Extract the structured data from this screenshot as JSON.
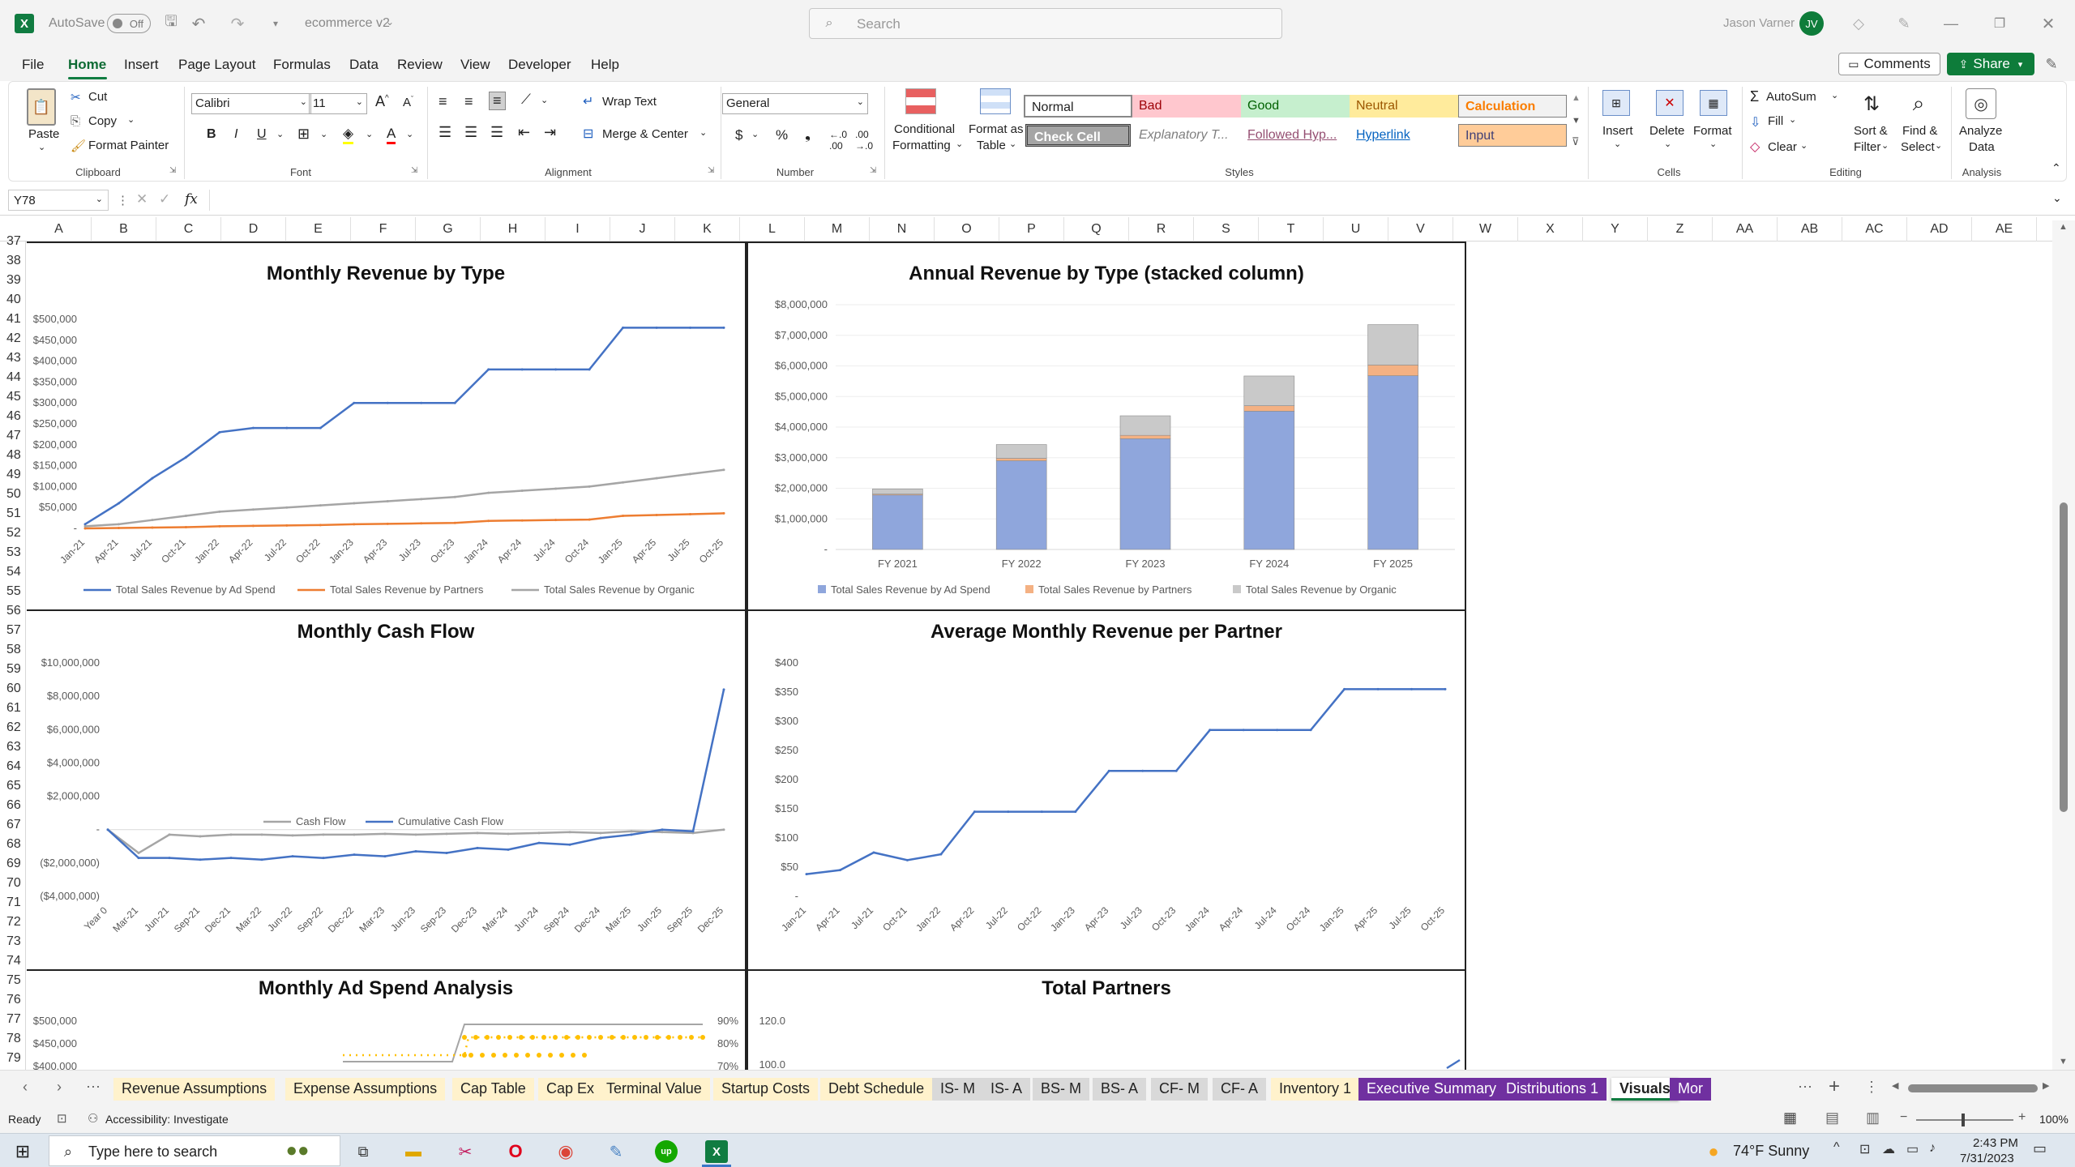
{
  "titlebar": {
    "autosave": "AutoSave",
    "autosave_state": "Off",
    "filename": "ecommerce v2",
    "search_placeholder": "Search",
    "user": "Jason Varner",
    "initials": "JV"
  },
  "menu": [
    "File",
    "Home",
    "Insert",
    "Page Layout",
    "Formulas",
    "Data",
    "Review",
    "View",
    "Developer",
    "Help"
  ],
  "menu_right": {
    "comments": "Comments",
    "share": "Share"
  },
  "ribbon": {
    "clipboard": {
      "paste": "Paste",
      "cut": "Cut",
      "copy": "Copy",
      "format_painter": "Format Painter",
      "label": "Clipboard"
    },
    "font": {
      "name": "Calibri",
      "size": "11",
      "label": "Font"
    },
    "alignment": {
      "wrap": "Wrap Text",
      "merge": "Merge & Center",
      "label": "Alignment"
    },
    "number": {
      "format": "General",
      "label": "Number"
    },
    "styles": {
      "conditional": "Conditional",
      "conditional2": "Formatting",
      "format_as": "Format as",
      "format_as2": "Table",
      "label": "Styles",
      "cells": [
        "Normal",
        "Bad",
        "Good",
        "Neutral",
        "Calculation",
        "Check Cell",
        "Explanatory T...",
        "Followed Hyp...",
        "Hyperlink",
        "Input"
      ]
    },
    "cells": {
      "insert": "Insert",
      "delete": "Delete",
      "format": "Format",
      "label": "Cells"
    },
    "editing": {
      "autosum": "AutoSum",
      "fill": "Fill",
      "clear": "Clear",
      "sort": "Sort &",
      "sort2": "Filter",
      "find": "Find &",
      "find2": "Select",
      "label": "Editing"
    },
    "analysis": {
      "analyze": "Analyze",
      "analyze2": "Data",
      "label": "Analysis"
    }
  },
  "formula_bar": {
    "name_box": "Y78",
    "fx": "fx"
  },
  "columns": [
    "A",
    "B",
    "C",
    "D",
    "E",
    "F",
    "G",
    "H",
    "I",
    "J",
    "K",
    "L",
    "M",
    "N",
    "O",
    "P",
    "Q",
    "R",
    "S",
    "T",
    "U",
    "V",
    "W",
    "X",
    "Y",
    "Z",
    "AA",
    "AB",
    "AC",
    "AD",
    "AE"
  ],
  "rows": [
    "37",
    "38",
    "39",
    "40",
    "41",
    "42",
    "43",
    "44",
    "45",
    "46",
    "47",
    "48",
    "49",
    "50",
    "51",
    "52",
    "53",
    "54",
    "55",
    "56",
    "57",
    "58",
    "59",
    "60",
    "61",
    "62",
    "63",
    "64",
    "65",
    "66",
    "67",
    "68",
    "69",
    "70",
    "71",
    "72",
    "73",
    "74",
    "75",
    "76",
    "77",
    "78",
    "79"
  ],
  "chart_data": [
    {
      "type": "line",
      "title": "Monthly Revenue by Type",
      "x": [
        "Jan-21",
        "Apr-21",
        "Jul-21",
        "Oct-21",
        "Jan-22",
        "Apr-22",
        "Jul-22",
        "Oct-22",
        "Jan-23",
        "Apr-23",
        "Jul-23",
        "Oct-23",
        "Jan-24",
        "Apr-24",
        "Jul-24",
        "Oct-24",
        "Jan-25",
        "Apr-25",
        "Jul-25",
        "Oct-25"
      ],
      "yticks": [
        "$500,000",
        "$450,000",
        "$400,000",
        "$350,000",
        "$300,000",
        "$250,000",
        "$200,000",
        "$150,000",
        "$100,000",
        "$50,000",
        "-"
      ],
      "ylim": [
        0,
        500000
      ],
      "series": [
        {
          "name": "Total Sales Revenue by Ad Spend",
          "color": "#4472c4",
          "values": [
            10000,
            60000,
            120000,
            170000,
            230000,
            240000,
            240000,
            240000,
            300000,
            300000,
            300000,
            300000,
            380000,
            380000,
            380000,
            380000,
            480000,
            480000,
            480000,
            480000
          ]
        },
        {
          "name": "Total Sales Revenue by Partners",
          "color": "#ed7d31",
          "values": [
            0,
            1000,
            2000,
            3000,
            5000,
            6000,
            7000,
            8000,
            10000,
            11000,
            12000,
            13000,
            18000,
            19000,
            20000,
            21000,
            30000,
            32000,
            34000,
            36000
          ]
        },
        {
          "name": "Total Sales Revenue by Organic",
          "color": "#a5a5a5",
          "values": [
            5000,
            10000,
            20000,
            30000,
            40000,
            45000,
            50000,
            55000,
            60000,
            65000,
            70000,
            75000,
            85000,
            90000,
            95000,
            100000,
            110000,
            120000,
            130000,
            140000
          ]
        }
      ]
    },
    {
      "type": "bar",
      "title": "Annual Revenue by Type (stacked column)",
      "categories": [
        "FY 2021",
        "FY 2022",
        "FY 2023",
        "FY 2024",
        "FY 2025"
      ],
      "yticks": [
        "$8,000,000",
        "$7,000,000",
        "$6,000,000",
        "$5,000,000",
        "$4,000,000",
        "$3,000,000",
        "$2,000,000",
        "$1,000,000",
        "-"
      ],
      "ylim": [
        0,
        8000000
      ],
      "series": [
        {
          "name": "Total Sales Revenue by Ad Spend",
          "color": "#8fa6dc",
          "values": [
            1780000,
            2900000,
            3620000,
            4520000,
            5680000
          ]
        },
        {
          "name": "Total Sales Revenue by Partners",
          "color": "#f4b183",
          "values": [
            30000,
            80000,
            110000,
            180000,
            350000
          ]
        },
        {
          "name": "Total Sales Revenue by Organic",
          "color": "#c9c9c9",
          "values": [
            170000,
            450000,
            640000,
            970000,
            1320000
          ]
        }
      ]
    },
    {
      "type": "line",
      "title": "Monthly Cash Flow",
      "x": [
        "Year 0",
        "Mar-21",
        "Jun-21",
        "Sep-21",
        "Dec-21",
        "Mar-22",
        "Jun-22",
        "Sep-22",
        "Dec-22",
        "Mar-23",
        "Jun-23",
        "Sep-23",
        "Dec-23",
        "Mar-24",
        "Jun-24",
        "Sep-24",
        "Dec-24",
        "Mar-25",
        "Jun-25",
        "Sep-25",
        "Dec-25"
      ],
      "yticks": [
        "$10,000,000",
        "$8,000,000",
        "$6,000,000",
        "$4,000,000",
        "$2,000,000",
        "-",
        "($2,000,000)",
        "($4,000,000)"
      ],
      "ylim": [
        -4000000,
        10000000
      ],
      "series": [
        {
          "name": "Cash Flow",
          "color": "#a5a5a5",
          "values": [
            0,
            -1400000,
            -300000,
            -400000,
            -300000,
            -300000,
            -350000,
            -300000,
            -300000,
            -250000,
            -300000,
            -250000,
            -200000,
            -250000,
            -200000,
            -150000,
            -200000,
            -100000,
            -150000,
            -200000,
            0
          ]
        },
        {
          "name": "Cumulative Cash Flow",
          "color": "#4472c4",
          "values": [
            0,
            -1700000,
            -1700000,
            -1800000,
            -1700000,
            -1800000,
            -1600000,
            -1700000,
            -1500000,
            -1600000,
            -1300000,
            -1400000,
            -1100000,
            -1200000,
            -800000,
            -900000,
            -500000,
            -300000,
            0,
            -100000,
            8400000
          ]
        }
      ]
    },
    {
      "type": "line",
      "title": "Average Monthly Revenue per Partner",
      "x": [
        "Jan-21",
        "Apr-21",
        "Jul-21",
        "Oct-21",
        "Jan-22",
        "Apr-22",
        "Jul-22",
        "Oct-22",
        "Jan-23",
        "Apr-23",
        "Jul-23",
        "Oct-23",
        "Jan-24",
        "Apr-24",
        "Jul-24",
        "Oct-24",
        "Jan-25",
        "Apr-25",
        "Jul-25",
        "Oct-25"
      ],
      "yticks": [
        "$400",
        "$350",
        "$300",
        "$250",
        "$200",
        "$150",
        "$100",
        "$50",
        "-"
      ],
      "ylim": [
        0,
        400
      ],
      "series": [
        {
          "name": "Average Monthly Revenue per Partner",
          "color": "#4472c4",
          "values": [
            38,
            45,
            75,
            62,
            72,
            145,
            145,
            145,
            145,
            215,
            215,
            215,
            285,
            285,
            285,
            285,
            355,
            355,
            355,
            355
          ]
        }
      ]
    },
    {
      "type": "line",
      "title": "Monthly Ad Spend Analysis",
      "yticks": [
        "$500,000",
        "$450,000",
        "$400,000"
      ],
      "y2ticks": [
        "90%",
        "80%",
        "70%"
      ]
    },
    {
      "type": "line",
      "title": "Total Partners",
      "yticks": [
        "120.0",
        "100.0"
      ]
    }
  ],
  "sheet_tabs": [
    {
      "label": "Revenue Assumptions",
      "bg": "#fff2cc",
      "fg": "#222"
    },
    {
      "label": "Expense Assumptions",
      "bg": "#fff2cc",
      "fg": "#222"
    },
    {
      "label": "Cap Table",
      "bg": "#fff2cc",
      "fg": "#222"
    },
    {
      "label": "Cap Ex",
      "bg": "#fff2cc",
      "fg": "#222"
    },
    {
      "label": "Terminal Value",
      "bg": "#fff2cc",
      "fg": "#222"
    },
    {
      "label": "Startup Costs",
      "bg": "#fff2cc",
      "fg": "#222"
    },
    {
      "label": "Debt Schedule",
      "bg": "#fff2cc",
      "fg": "#222"
    },
    {
      "label": "IS- M",
      "bg": "#d9d9d9",
      "fg": "#222"
    },
    {
      "label": "IS- A",
      "bg": "#d9d9d9",
      "fg": "#222"
    },
    {
      "label": "BS- M",
      "bg": "#d9d9d9",
      "fg": "#222"
    },
    {
      "label": "BS- A",
      "bg": "#d9d9d9",
      "fg": "#222"
    },
    {
      "label": "CF- M",
      "bg": "#d9d9d9",
      "fg": "#222"
    },
    {
      "label": "CF- A",
      "bg": "#d9d9d9",
      "fg": "#222"
    },
    {
      "label": "Inventory 1",
      "bg": "#fff2cc",
      "fg": "#222"
    },
    {
      "label": "Executive Summary",
      "bg": "#7030a0",
      "fg": "#fff"
    },
    {
      "label": "Distributions 1",
      "bg": "#7030a0",
      "fg": "#fff"
    },
    {
      "label": "Visuals",
      "bg": "#ffffff",
      "fg": "#222",
      "active": true
    },
    {
      "label": "Mor",
      "bg": "#7030a0",
      "fg": "#fff"
    }
  ],
  "status": {
    "ready": "Ready",
    "accessibility": "Accessibility: Investigate",
    "zoom": "100%"
  },
  "taskbar": {
    "search": "Type here to search",
    "weather": "74°F  Sunny",
    "time": "2:43 PM",
    "date": "7/31/2023"
  }
}
